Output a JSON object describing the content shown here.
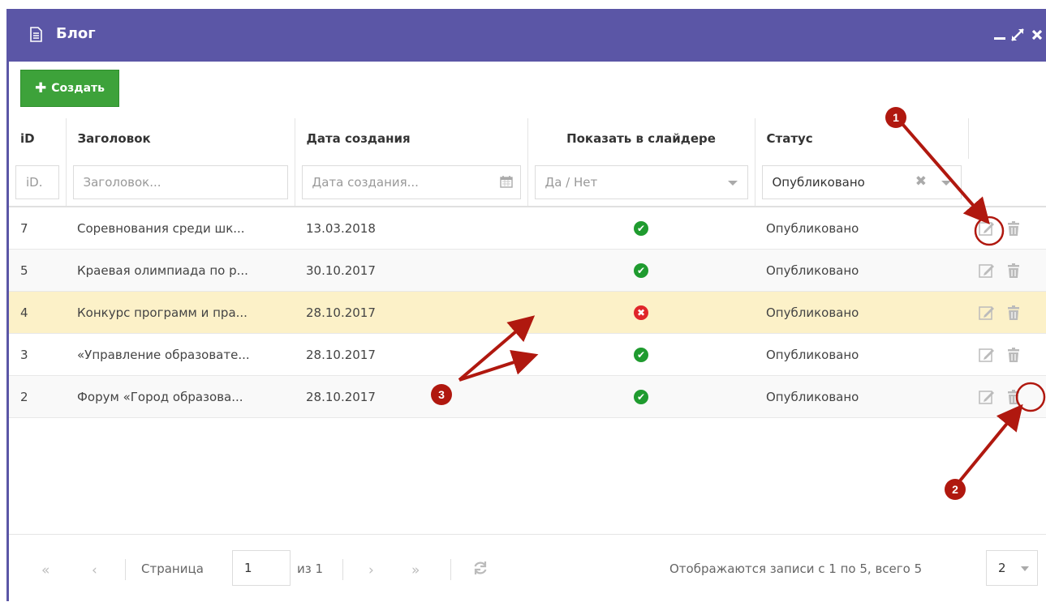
{
  "window": {
    "title": "Блог",
    "title_icon": "document-icon",
    "controls": [
      "minimize-icon",
      "maximize-icon",
      "close-icon"
    ],
    "header_color": "#5b56a6"
  },
  "toolbar": {
    "create_label": "Создать",
    "create_color": "#3da23a"
  },
  "grid": {
    "columns": {
      "id": "iD",
      "title": "Заголовок",
      "created": "Дата создания",
      "slider": "Показать в слайдере",
      "status": "Статус"
    },
    "filters": {
      "id_placeholder": "iD.",
      "title_placeholder": "Заголовок...",
      "created_placeholder": "Дата создания...",
      "slider_placeholder": "Да / Нет",
      "status_value": "Опубликовано"
    },
    "rows": [
      {
        "id": "7",
        "title": "Соревнования среди шк...",
        "date": "13.03.2018",
        "slider": true,
        "status": "Опубликовано"
      },
      {
        "id": "5",
        "title": "Краевая олимпиада по р...",
        "date": "30.10.2017",
        "slider": true,
        "status": "Опубликовано"
      },
      {
        "id": "4",
        "title": "Конкурс программ и пра...",
        "date": "28.10.2017",
        "slider": false,
        "status": "Опубликовано"
      },
      {
        "id": "3",
        "title": "«Управление образовате...",
        "date": "28.10.2017",
        "slider": true,
        "status": "Опубликовано"
      },
      {
        "id": "2",
        "title": "Форум «Город образова...",
        "date": "28.10.2017",
        "slider": true,
        "status": "Опубликовано"
      }
    ],
    "selected_row_color": "#fcf1c8"
  },
  "pager": {
    "page_label": "Страница",
    "page_value": "1",
    "of_label": "из 1",
    "records_info": "Отображаются записи с 1 по 5, всего 5",
    "page_size": "2"
  },
  "annotations": {
    "badge1": "1",
    "badge2": "2",
    "badge3": "3",
    "color": "#b0180f"
  }
}
